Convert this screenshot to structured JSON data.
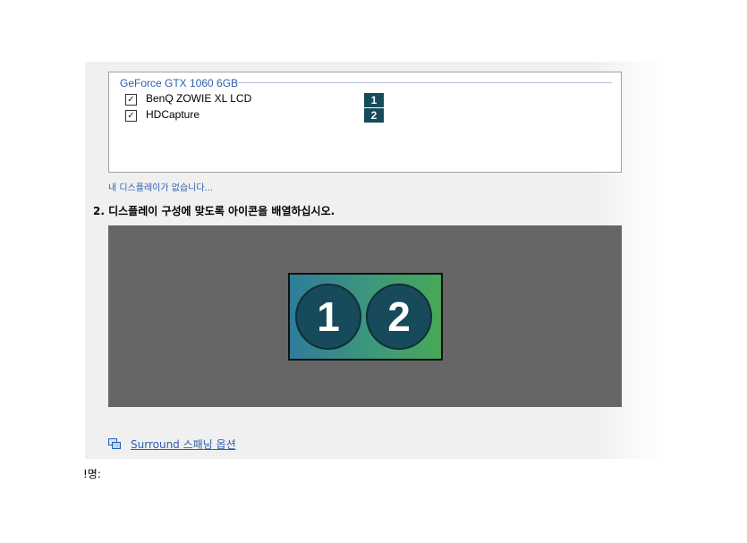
{
  "gpu_group": {
    "title": "GeForce GTX 1060 6GB",
    "displays": [
      {
        "name": "BenQ ZOWIE XL LCD",
        "number": "1",
        "checked": true
      },
      {
        "name": "HDCapture",
        "number": "2",
        "checked": true
      }
    ]
  },
  "missing_display_link": "내 디스플레이가 없습니다...",
  "step2": {
    "title": "2. 디스플레이 구성에 맞도록 아이콘을 배열하십시오."
  },
  "arrangement": {
    "monitors": [
      "1",
      "2"
    ],
    "canvas_color": "#666666",
    "circle_color": "#174a5a"
  },
  "surround_link": {
    "icon": "surround-span-icon",
    "label": "Surround 스패닝 옵션"
  },
  "bottom_label": "!명:",
  "colors": {
    "link": "#2b5fae",
    "badge": "#174a5a"
  }
}
